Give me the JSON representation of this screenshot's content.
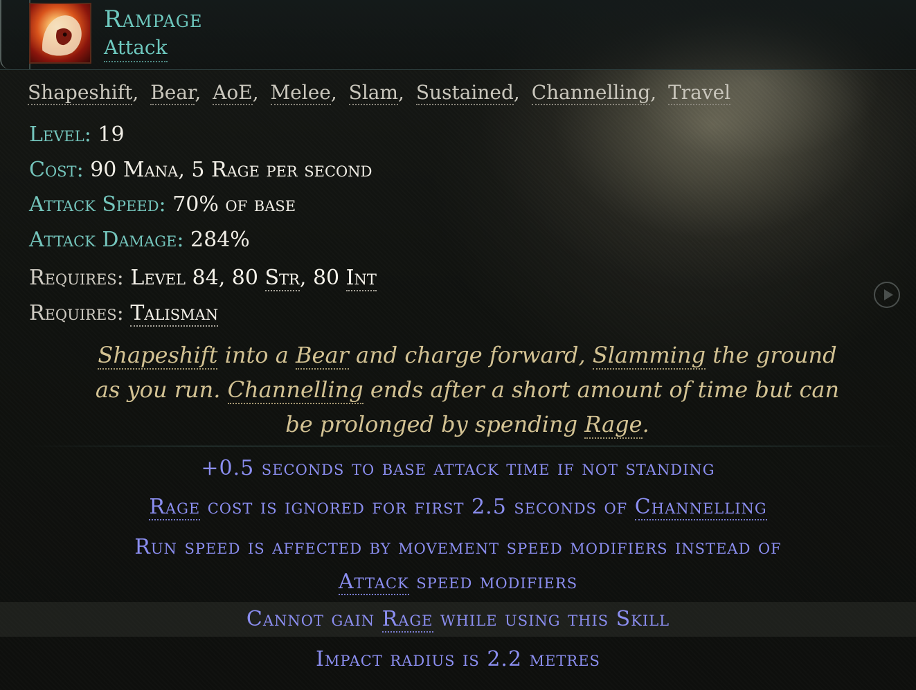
{
  "skill": {
    "name": "Rampage",
    "type": "Attack",
    "icon": "bear-rampage-icon"
  },
  "tags": [
    "Shapeshift",
    "Bear",
    "AoE",
    "Melee",
    "Slam",
    "Sustained",
    "Channelling",
    "Travel"
  ],
  "stats": {
    "level_label": "Level:",
    "level_value": "19",
    "cost_label": "Cost:",
    "cost_value": "90 Mana, 5 Rage per second",
    "attack_speed_label": "Attack Speed:",
    "attack_speed_value": "70% of base",
    "attack_damage_label": "Attack Damage:",
    "attack_damage_value": "284%"
  },
  "requirements": {
    "label": "Requires:",
    "line1_prefix": "Level 84, 80 ",
    "line1_str": "Str",
    "line1_mid": ", 80 ",
    "line1_int": "Int",
    "weapon": "Talisman"
  },
  "description": {
    "p1": "Shapeshift",
    "p2": " into a ",
    "p3": "Bear",
    "p4": " and charge forward, ",
    "p5": "Slamming",
    "p6": " the ground as you run. ",
    "p7": "Channelling",
    "p8": " ends after a short amount of time but can be prolonged by spending ",
    "p9": "Rage",
    "p10": "."
  },
  "mods": {
    "m1": "+0.5 seconds to base attack time if not standing",
    "m2_kw1": "Rage",
    "m2_mid": " cost is ignored for first 2.5 seconds of ",
    "m2_kw2": "Channelling",
    "m3_line1": "Run speed is affected by movement speed modifiers instead of",
    "m3_kw": "Attack",
    "m3_rest": " speed modifiers",
    "m4_pre": "Cannot gain ",
    "m4_kw1": "Rage",
    "m4_mid": " while using this ",
    "m4_kw2": "Skill",
    "m5": "Impact radius is 2.2 metres"
  },
  "colors": {
    "skill_name": "#6ec9bf",
    "stat_label": "#74c5bc",
    "description": "#d3c293",
    "mods": "#8b8ef0"
  }
}
